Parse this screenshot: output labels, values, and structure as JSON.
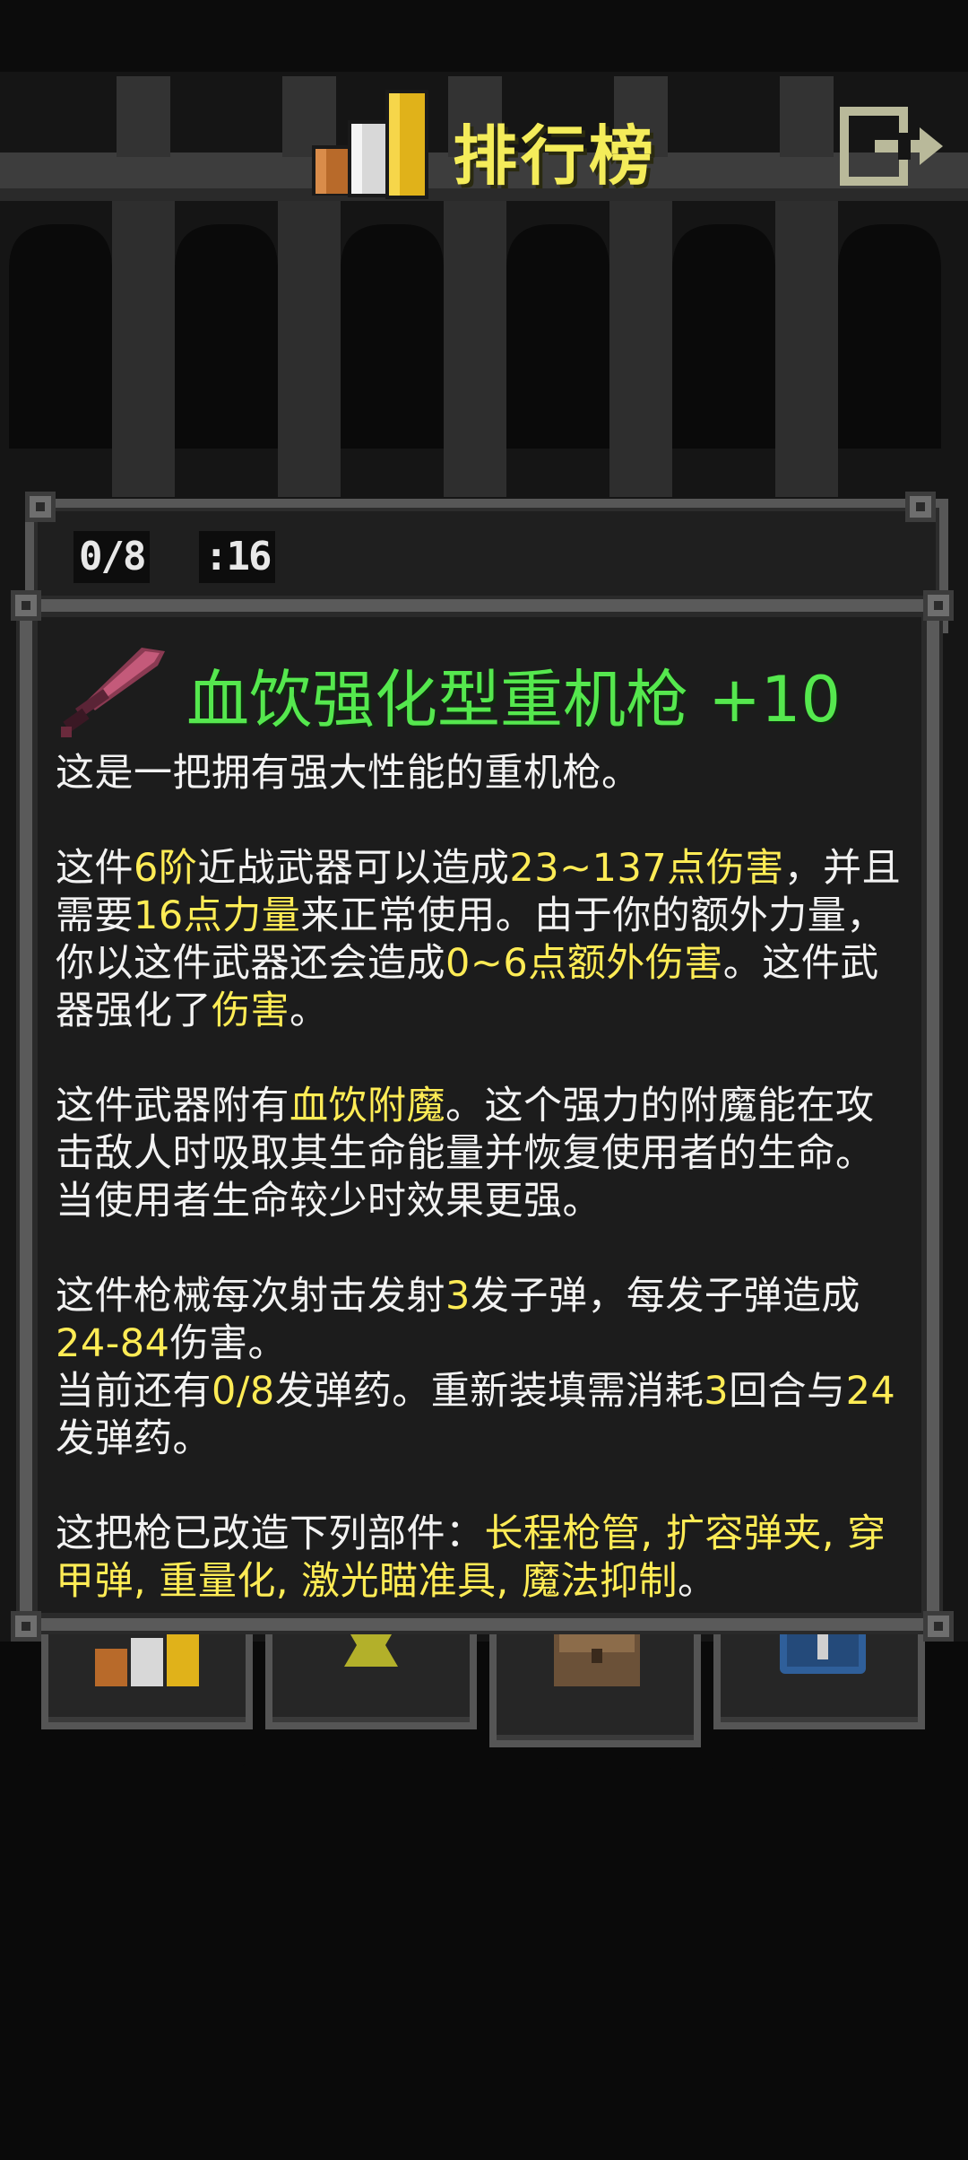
{
  "header": {
    "title": "排行榜",
    "rank_icon": "rankings-bars-icon",
    "exit_icon": "exit-icon"
  },
  "back_window": {
    "ammo": "0/8",
    "time": ":16"
  },
  "item": {
    "icon": "sword-icon",
    "title": "血饮强化型重机枪 +10",
    "p1": "这是一把拥有强大性能的重机枪。",
    "p2": {
      "a": "这件",
      "tier": "6阶",
      "b": "近战武器可以造成",
      "damage": "23~137点伤害",
      "c": "，并且需要",
      "str": "16点力量",
      "d": "来正常使用。由于你的额外力量，你以这件武器还会造成",
      "bonus": "0~6点额外伤害",
      "e": "。这件武器强化了",
      "upgraded": "伤害",
      "f": "。"
    },
    "p3": {
      "a": "这件武器附有",
      "ench": "血饮附魔",
      "b": "。这个强力的附魔能在攻击敌人时吸取其生命能量并恢复使用者的生命。当使用者生命较少时效果更强。"
    },
    "p4": {
      "a": "这件枪械每次射击发射",
      "shots": "3",
      "b": "发子弹，每发子弹造成",
      "bullet_dmg": "24-84",
      "c": "伤害。"
    },
    "p5": {
      "a": "当前还有",
      "ammo": "0/8",
      "b": "发弹药。重新装填需消耗",
      "turns": "3",
      "c": "回合与",
      "reload_ammo": "24",
      "d": "发弹药。"
    },
    "p6": {
      "a": "这把枪已改造下列部件：",
      "parts": "长程枪管, 扩容弹夹, 穿甲弹, 重量化, 激光瞄准具, 魔法抑制",
      "b": "。"
    }
  },
  "colors": {
    "title_green": "#55e84e",
    "highlight_yellow": "#ffec55",
    "header_yellow": "#f4ec5a",
    "dialog_bg": "#1c1c1c",
    "frame": "#5a5a5a"
  }
}
